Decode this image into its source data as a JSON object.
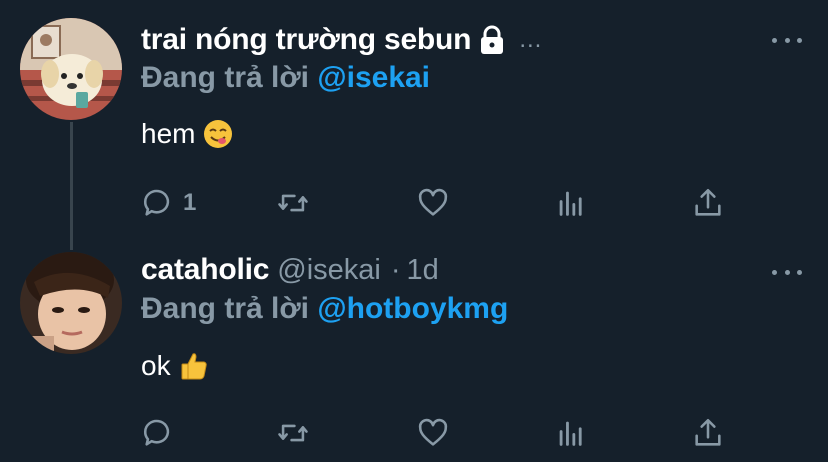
{
  "tweets": [
    {
      "name": "trai nóng trường sebun",
      "replying_prefix": "Đang trả lời ",
      "replying_to": "@isekai",
      "text": "hem",
      "emoji": "yum-face-emoji",
      "reply_count": "1",
      "protected_icon": "lock-icon"
    },
    {
      "name": "cataholic",
      "handle": "@isekai",
      "separator": "·",
      "time": "1d",
      "replying_prefix": "Đang trả lời ",
      "replying_to": "@hotboykmg",
      "text": "ok",
      "emoji": "thumbs-up-emoji"
    }
  ],
  "icons": [
    "reply-icon",
    "retweet-icon",
    "like-icon",
    "analytics-icon",
    "share-icon",
    "more-icon"
  ],
  "colors": {
    "background": "#15202b",
    "text": "#ffffff",
    "secondary": "#8899a6",
    "accent": "#1da1f2",
    "thread_line": "#38444d"
  }
}
